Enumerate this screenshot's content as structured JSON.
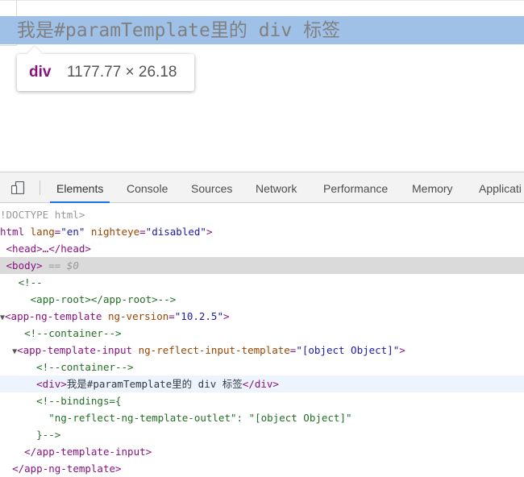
{
  "page": {
    "rendered_text": "我是#paramTemplate里的 div 标签",
    "tooltip": {
      "tag": "div",
      "size": "1177.77 × 26.18"
    }
  },
  "devtools": {
    "tabs": [
      {
        "label": "Elements",
        "active": true
      },
      {
        "label": "Console",
        "active": false
      },
      {
        "label": "Sources",
        "active": false
      },
      {
        "label": "Network",
        "active": false
      },
      {
        "label": "Performance",
        "active": false
      },
      {
        "label": "Memory",
        "active": false
      },
      {
        "label": "Applicati",
        "active": false
      }
    ],
    "icons": [
      "device-toggle-icon"
    ],
    "dom": {
      "doctype": "!DOCTYPE html>",
      "html": {
        "open": "html",
        "attr1_name": "lang",
        "attr1_val": "\"en\"",
        "attr2_name": "nighteye",
        "attr2_val": "\"disabled\""
      },
      "head": {
        "text": "<head>…</head>"
      },
      "body": {
        "text": "<body>",
        "marker": "== $0"
      },
      "comment_open": "<!--",
      "comment_app_root": "<app-root></app-root>-->",
      "app_ng_template": {
        "tag": "<app-ng-template",
        "attr_name": "ng-version",
        "attr_val": "\"10.2.5\"",
        "close": ">"
      },
      "container_comment_1": "<!--container-->",
      "app_template_input": {
        "tag": "<app-template-input",
        "attr_name": "ng-reflect-input-template",
        "attr_val": "\"[object Object]\"",
        "close": ">"
      },
      "container_comment_2": "<!--container-->",
      "div_line": {
        "open": "<div>",
        "text": "我是#paramTemplate里的 div 标签",
        "close": "</div>"
      },
      "bindings_open": "<!--bindings={",
      "bindings_body": "\"ng-reflect-ng-template-outlet\": \"[object Object]\"",
      "bindings_close": "}-->",
      "close_template_input": "</app-template-input>",
      "close_ng_template": "</app-ng-template>"
    }
  }
}
